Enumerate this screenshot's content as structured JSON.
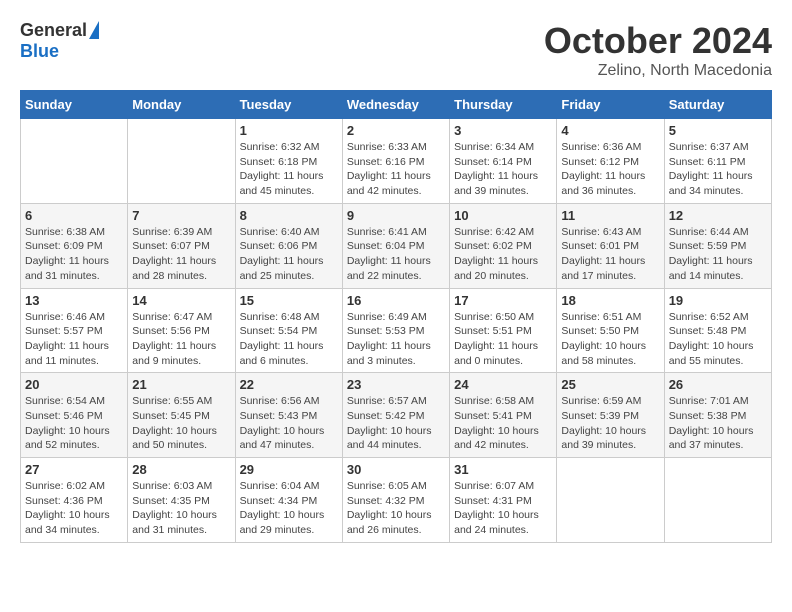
{
  "header": {
    "logo_general": "General",
    "logo_blue": "Blue",
    "month_year": "October 2024",
    "location": "Zelino, North Macedonia"
  },
  "weekdays": [
    "Sunday",
    "Monday",
    "Tuesday",
    "Wednesday",
    "Thursday",
    "Friday",
    "Saturday"
  ],
  "weeks": [
    [
      {
        "day": "",
        "sunrise": "",
        "sunset": "",
        "daylight": ""
      },
      {
        "day": "",
        "sunrise": "",
        "sunset": "",
        "daylight": ""
      },
      {
        "day": "1",
        "sunrise": "Sunrise: 6:32 AM",
        "sunset": "Sunset: 6:18 PM",
        "daylight": "Daylight: 11 hours and 45 minutes."
      },
      {
        "day": "2",
        "sunrise": "Sunrise: 6:33 AM",
        "sunset": "Sunset: 6:16 PM",
        "daylight": "Daylight: 11 hours and 42 minutes."
      },
      {
        "day": "3",
        "sunrise": "Sunrise: 6:34 AM",
        "sunset": "Sunset: 6:14 PM",
        "daylight": "Daylight: 11 hours and 39 minutes."
      },
      {
        "day": "4",
        "sunrise": "Sunrise: 6:36 AM",
        "sunset": "Sunset: 6:12 PM",
        "daylight": "Daylight: 11 hours and 36 minutes."
      },
      {
        "day": "5",
        "sunrise": "Sunrise: 6:37 AM",
        "sunset": "Sunset: 6:11 PM",
        "daylight": "Daylight: 11 hours and 34 minutes."
      }
    ],
    [
      {
        "day": "6",
        "sunrise": "Sunrise: 6:38 AM",
        "sunset": "Sunset: 6:09 PM",
        "daylight": "Daylight: 11 hours and 31 minutes."
      },
      {
        "day": "7",
        "sunrise": "Sunrise: 6:39 AM",
        "sunset": "Sunset: 6:07 PM",
        "daylight": "Daylight: 11 hours and 28 minutes."
      },
      {
        "day": "8",
        "sunrise": "Sunrise: 6:40 AM",
        "sunset": "Sunset: 6:06 PM",
        "daylight": "Daylight: 11 hours and 25 minutes."
      },
      {
        "day": "9",
        "sunrise": "Sunrise: 6:41 AM",
        "sunset": "Sunset: 6:04 PM",
        "daylight": "Daylight: 11 hours and 22 minutes."
      },
      {
        "day": "10",
        "sunrise": "Sunrise: 6:42 AM",
        "sunset": "Sunset: 6:02 PM",
        "daylight": "Daylight: 11 hours and 20 minutes."
      },
      {
        "day": "11",
        "sunrise": "Sunrise: 6:43 AM",
        "sunset": "Sunset: 6:01 PM",
        "daylight": "Daylight: 11 hours and 17 minutes."
      },
      {
        "day": "12",
        "sunrise": "Sunrise: 6:44 AM",
        "sunset": "Sunset: 5:59 PM",
        "daylight": "Daylight: 11 hours and 14 minutes."
      }
    ],
    [
      {
        "day": "13",
        "sunrise": "Sunrise: 6:46 AM",
        "sunset": "Sunset: 5:57 PM",
        "daylight": "Daylight: 11 hours and 11 minutes."
      },
      {
        "day": "14",
        "sunrise": "Sunrise: 6:47 AM",
        "sunset": "Sunset: 5:56 PM",
        "daylight": "Daylight: 11 hours and 9 minutes."
      },
      {
        "day": "15",
        "sunrise": "Sunrise: 6:48 AM",
        "sunset": "Sunset: 5:54 PM",
        "daylight": "Daylight: 11 hours and 6 minutes."
      },
      {
        "day": "16",
        "sunrise": "Sunrise: 6:49 AM",
        "sunset": "Sunset: 5:53 PM",
        "daylight": "Daylight: 11 hours and 3 minutes."
      },
      {
        "day": "17",
        "sunrise": "Sunrise: 6:50 AM",
        "sunset": "Sunset: 5:51 PM",
        "daylight": "Daylight: 11 hours and 0 minutes."
      },
      {
        "day": "18",
        "sunrise": "Sunrise: 6:51 AM",
        "sunset": "Sunset: 5:50 PM",
        "daylight": "Daylight: 10 hours and 58 minutes."
      },
      {
        "day": "19",
        "sunrise": "Sunrise: 6:52 AM",
        "sunset": "Sunset: 5:48 PM",
        "daylight": "Daylight: 10 hours and 55 minutes."
      }
    ],
    [
      {
        "day": "20",
        "sunrise": "Sunrise: 6:54 AM",
        "sunset": "Sunset: 5:46 PM",
        "daylight": "Daylight: 10 hours and 52 minutes."
      },
      {
        "day": "21",
        "sunrise": "Sunrise: 6:55 AM",
        "sunset": "Sunset: 5:45 PM",
        "daylight": "Daylight: 10 hours and 50 minutes."
      },
      {
        "day": "22",
        "sunrise": "Sunrise: 6:56 AM",
        "sunset": "Sunset: 5:43 PM",
        "daylight": "Daylight: 10 hours and 47 minutes."
      },
      {
        "day": "23",
        "sunrise": "Sunrise: 6:57 AM",
        "sunset": "Sunset: 5:42 PM",
        "daylight": "Daylight: 10 hours and 44 minutes."
      },
      {
        "day": "24",
        "sunrise": "Sunrise: 6:58 AM",
        "sunset": "Sunset: 5:41 PM",
        "daylight": "Daylight: 10 hours and 42 minutes."
      },
      {
        "day": "25",
        "sunrise": "Sunrise: 6:59 AM",
        "sunset": "Sunset: 5:39 PM",
        "daylight": "Daylight: 10 hours and 39 minutes."
      },
      {
        "day": "26",
        "sunrise": "Sunrise: 7:01 AM",
        "sunset": "Sunset: 5:38 PM",
        "daylight": "Daylight: 10 hours and 37 minutes."
      }
    ],
    [
      {
        "day": "27",
        "sunrise": "Sunrise: 6:02 AM",
        "sunset": "Sunset: 4:36 PM",
        "daylight": "Daylight: 10 hours and 34 minutes."
      },
      {
        "day": "28",
        "sunrise": "Sunrise: 6:03 AM",
        "sunset": "Sunset: 4:35 PM",
        "daylight": "Daylight: 10 hours and 31 minutes."
      },
      {
        "day": "29",
        "sunrise": "Sunrise: 6:04 AM",
        "sunset": "Sunset: 4:34 PM",
        "daylight": "Daylight: 10 hours and 29 minutes."
      },
      {
        "day": "30",
        "sunrise": "Sunrise: 6:05 AM",
        "sunset": "Sunset: 4:32 PM",
        "daylight": "Daylight: 10 hours and 26 minutes."
      },
      {
        "day": "31",
        "sunrise": "Sunrise: 6:07 AM",
        "sunset": "Sunset: 4:31 PM",
        "daylight": "Daylight: 10 hours and 24 minutes."
      },
      {
        "day": "",
        "sunrise": "",
        "sunset": "",
        "daylight": ""
      },
      {
        "day": "",
        "sunrise": "",
        "sunset": "",
        "daylight": ""
      }
    ]
  ]
}
